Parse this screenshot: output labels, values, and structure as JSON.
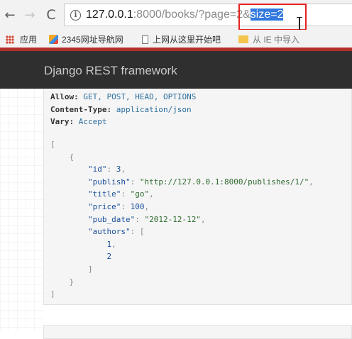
{
  "browser": {
    "url_host": "127.0.0.1",
    "url_path": ":8000/books/?page=2&",
    "url_selected": "size=2",
    "back_glyph": "←",
    "forward_glyph": "→",
    "reload_glyph": "C",
    "info_glyph": "i"
  },
  "bookmarks": [
    {
      "label": "应用",
      "icon": "apps-grid-icon"
    },
    {
      "label": "2345网址导航网",
      "icon": "2345-logo-icon"
    },
    {
      "label": "上网从这里开始吧",
      "icon": "page-icon"
    },
    {
      "label": "从 IE 中导入",
      "icon": "folder-icon"
    }
  ],
  "navbar": {
    "brand": "Django REST framework"
  },
  "response": {
    "headers": [
      {
        "key": "Allow:",
        "value": "GET, POST, HEAD, OPTIONS"
      },
      {
        "key": "Content-Type:",
        "value": "application/json"
      },
      {
        "key": "Vary:",
        "value": "Accept"
      }
    ],
    "json": {
      "id": 3,
      "publish": "http://127.0.0.1:8000/publishes/1/",
      "title": "go",
      "price": 100,
      "pub_date": "2012-12-12",
      "authors": [
        1,
        2
      ]
    },
    "json_keys": {
      "id": "\"id\"",
      "publish": "\"publish\"",
      "title": "\"title\"",
      "price": "\"price\"",
      "pub_date": "\"pub_date\"",
      "authors": "\"authors\""
    },
    "json_strings": {
      "publish": "\"http://127.0.0.1:8000/publishes/1/\"",
      "title": "\"go\"",
      "pub_date": "\"2012-12-12\""
    }
  },
  "colors": {
    "annotation_box": "#e52020",
    "navbar_bg": "#2f2f2f",
    "accent_strip": "#b4302a",
    "selection": "#3178e0"
  }
}
